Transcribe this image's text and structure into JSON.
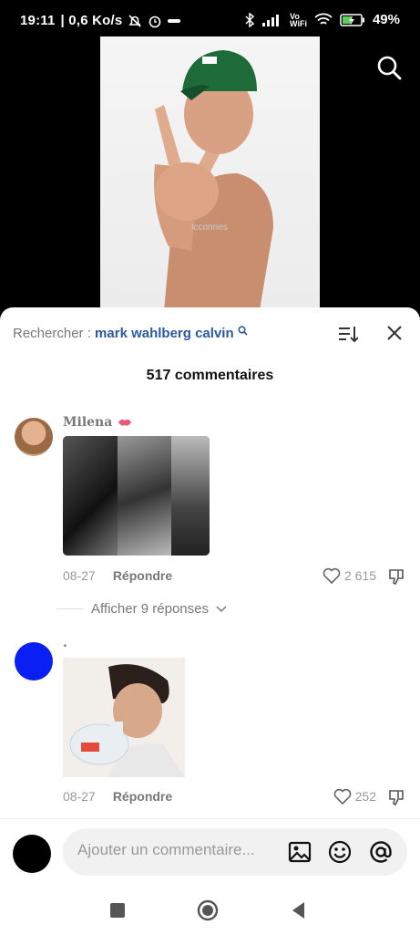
{
  "status_bar": {
    "time": "19:11",
    "speed": "| 0,6 Ko/s",
    "battery": "49%",
    "volte": "Vo\nWiFi"
  },
  "video": {
    "watermark": "icconnes"
  },
  "search": {
    "label": "Rechercher :",
    "query": "mark wahlberg calvin"
  },
  "comments_count": "517 commentaires",
  "comments": [
    {
      "name": "Milena",
      "date": "08-27",
      "reply_label": "Répondre",
      "likes": "2 615",
      "show_replies": "Afficher 9 réponses"
    },
    {
      "name": ".",
      "date": "08-27",
      "reply_label": "Répondre",
      "likes": "252",
      "avatar_color": "#0a1ff2"
    }
  ],
  "composer": {
    "placeholder": "Ajouter un commentaire..."
  }
}
